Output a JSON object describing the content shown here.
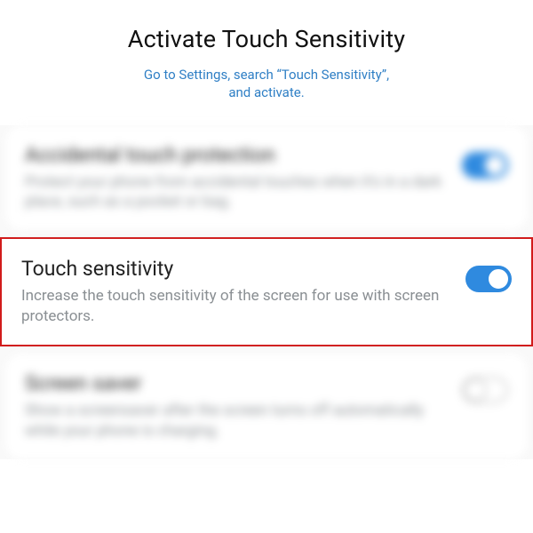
{
  "header": {
    "title": "Activate Touch Sensitivity",
    "subtitle_line1": "Go to Settings, search “Touch Sensitivity”,",
    "subtitle_line2": "and activate."
  },
  "rows": [
    {
      "title": "Accidental touch protection",
      "desc": "Protect your phone from accidental touches when it's in a dark place, such as a pocket or bag.",
      "toggle": "on"
    },
    {
      "title": "Touch sensitivity",
      "desc": "Increase the touch sensitivity of the screen for use with screen protectors.",
      "toggle": "on"
    },
    {
      "title": "Screen saver",
      "desc": "Show a screensaver after the screen turns off automatically while your phone is charging.",
      "toggle": "off"
    }
  ],
  "colors": {
    "accent": "#2f8adf",
    "highlight_border": "#d11b1b",
    "link": "#2f7fc5"
  }
}
